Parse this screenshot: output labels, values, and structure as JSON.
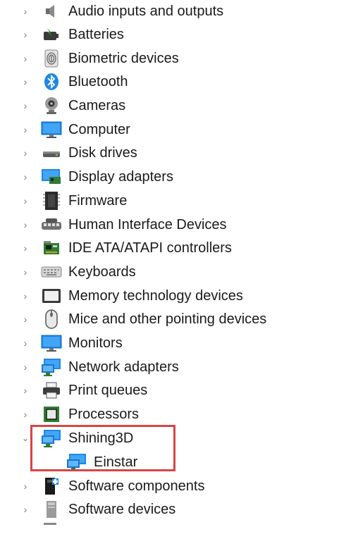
{
  "tree": {
    "items": [
      {
        "label": "Audio inputs and outputs",
        "icon": "speaker-icon",
        "expanded": false
      },
      {
        "label": "Batteries",
        "icon": "battery-icon",
        "expanded": false
      },
      {
        "label": "Biometric devices",
        "icon": "fingerprint-icon",
        "expanded": false
      },
      {
        "label": "Bluetooth",
        "icon": "bluetooth-icon",
        "expanded": false
      },
      {
        "label": "Cameras",
        "icon": "webcam-icon",
        "expanded": false
      },
      {
        "label": "Computer",
        "icon": "monitor-icon",
        "expanded": false
      },
      {
        "label": "Disk drives",
        "icon": "disk-drive-icon",
        "expanded": false
      },
      {
        "label": "Display adapters",
        "icon": "display-adapter-icon",
        "expanded": false
      },
      {
        "label": "Firmware",
        "icon": "firmware-chip-icon",
        "expanded": false
      },
      {
        "label": "Human Interface Devices",
        "icon": "hid-icon",
        "expanded": false
      },
      {
        "label": "IDE ATA/ATAPI controllers",
        "icon": "ide-controller-icon",
        "expanded": false
      },
      {
        "label": "Keyboards",
        "icon": "keyboard-icon",
        "expanded": false
      },
      {
        "label": "Memory technology devices",
        "icon": "memory-device-icon",
        "expanded": false
      },
      {
        "label": "Mice and other pointing devices",
        "icon": "mouse-icon",
        "expanded": false
      },
      {
        "label": "Monitors",
        "icon": "monitor-icon",
        "expanded": false
      },
      {
        "label": "Network adapters",
        "icon": "network-adapter-icon",
        "expanded": false
      },
      {
        "label": "Print queues",
        "icon": "printer-icon",
        "expanded": false
      },
      {
        "label": "Processors",
        "icon": "processor-icon",
        "expanded": false
      },
      {
        "label": "Shining3D",
        "icon": "network-adapter-icon",
        "expanded": true,
        "children": [
          {
            "label": "Einstar",
            "icon": "network-adapter-icon"
          }
        ]
      },
      {
        "label": "Software components",
        "icon": "software-component-icon",
        "expanded": false
      },
      {
        "label": "Software devices",
        "icon": "software-device-icon",
        "expanded": false
      }
    ]
  },
  "colors": {
    "highlight_border": "#d64545",
    "icon_blue": "#1e88e5",
    "text": "#1a1a1a"
  }
}
